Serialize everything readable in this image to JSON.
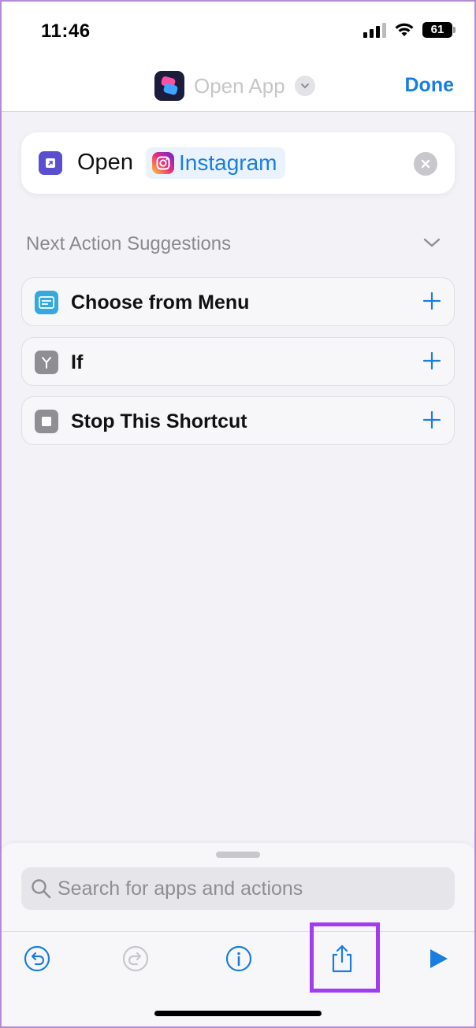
{
  "status_bar": {
    "time": "11:46",
    "battery": "61"
  },
  "nav": {
    "title": "Open App",
    "done_label": "Done"
  },
  "action": {
    "verb": "Open",
    "app_name": "Instagram"
  },
  "suggestions": {
    "title": "Next Action Suggestions",
    "items": [
      {
        "label": "Choose from Menu",
        "icon": "menu-icon",
        "color": "#35a8e0"
      },
      {
        "label": "If",
        "icon": "branch-icon",
        "color": "#8e8e93"
      },
      {
        "label": "Stop This Shortcut",
        "icon": "stop-icon",
        "color": "#8e8e93"
      }
    ]
  },
  "search": {
    "placeholder": "Search for apps and actions"
  },
  "toolbar": {
    "icons": [
      "undo-icon",
      "redo-icon",
      "info-icon",
      "share-icon",
      "play-icon"
    ]
  },
  "colors": {
    "accent": "#1a7de0",
    "highlight": "#a13cf0",
    "background": "#f2f2f7"
  }
}
